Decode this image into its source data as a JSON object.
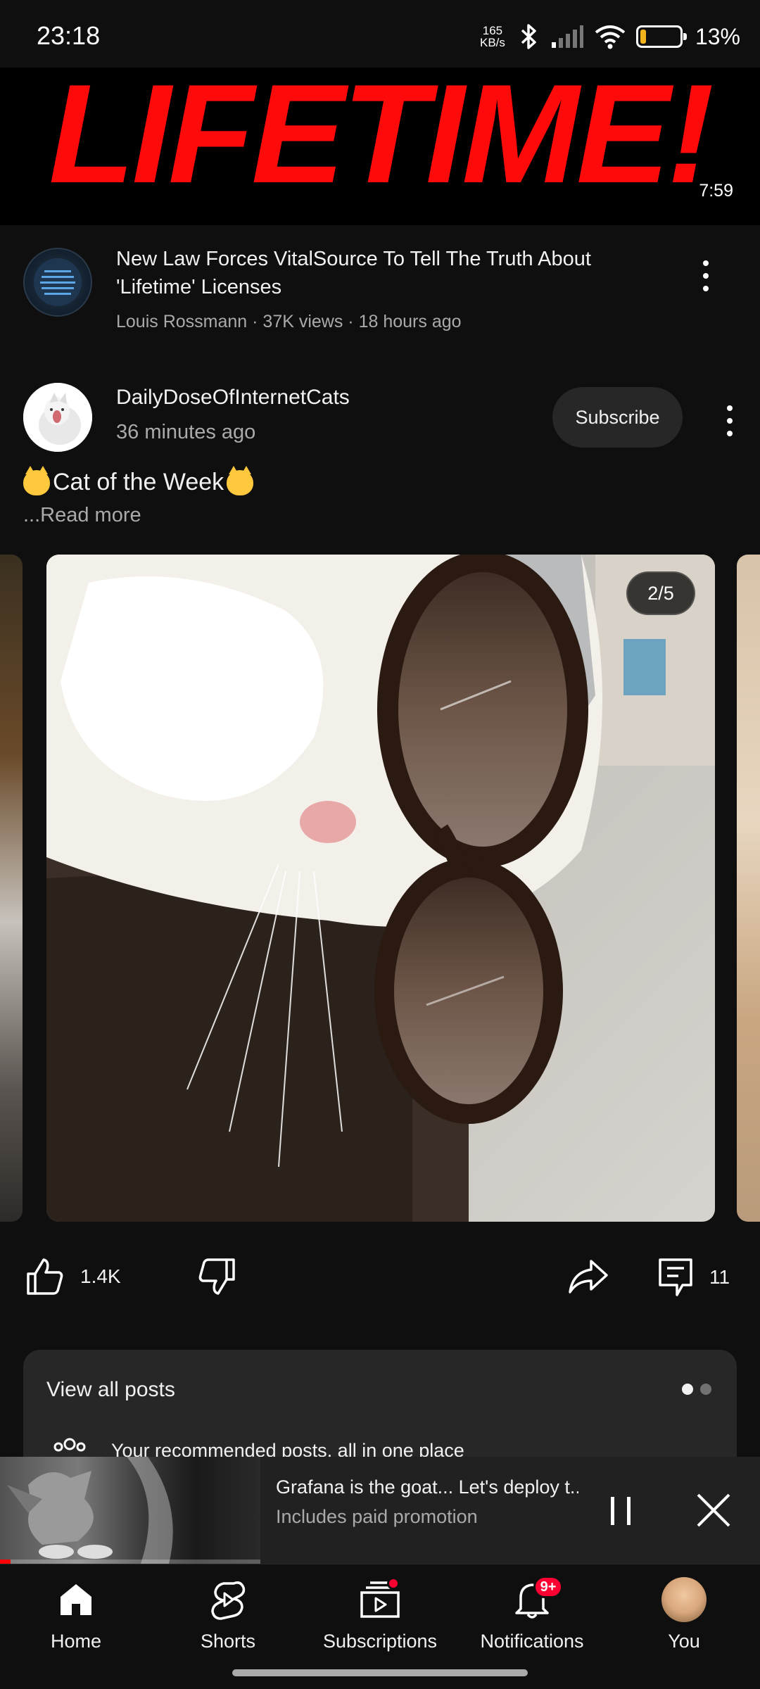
{
  "status_bar": {
    "time": "23:18",
    "net_speed_value": "165",
    "net_speed_unit": "KB/s",
    "battery_percent": "13%",
    "battery_level": 0.13
  },
  "top_video": {
    "thumbnail_text": "LIFETIME!",
    "duration": "7:59",
    "title": "New Law Forces VitalSource To Tell The Truth About 'Lifetime' Licenses",
    "meta": "Louis Rossmann · 37K views · 18 hours ago"
  },
  "post": {
    "channel": "DailyDoseOfInternetCats",
    "time": "36 minutes ago",
    "subscribe_label": "Subscribe",
    "text": "Cat of the Week",
    "read_more": "...Read more",
    "slide_counter": "2/5",
    "likes": "1.4K",
    "comments": "11"
  },
  "posts_card": {
    "title": "View all posts",
    "subtitle": "Your recommended posts, all in one place"
  },
  "mini_player": {
    "title": "Grafana is the goat... Let's deploy t...",
    "subtitle": "Includes paid promotion",
    "progress": 0.04
  },
  "nav": {
    "home": "Home",
    "shorts": "Shorts",
    "subscriptions": "Subscriptions",
    "notifications": "Notifications",
    "notifications_badge": "9+",
    "you": "You"
  },
  "colors": {
    "background": "#0f0f0f",
    "accent_red": "#ff0033",
    "thumbnail_red": "#ff0a0a",
    "surface": "#272727"
  }
}
